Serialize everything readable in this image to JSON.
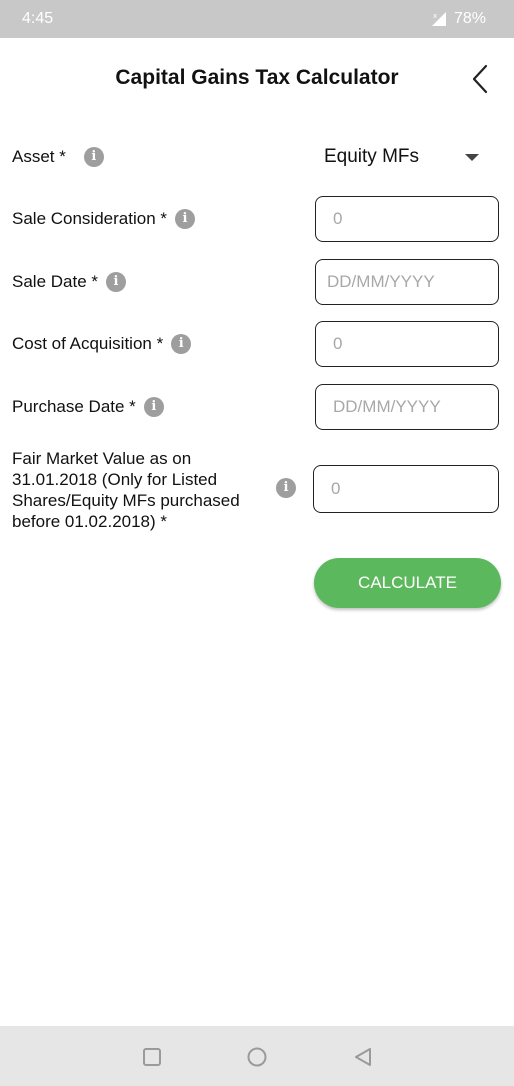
{
  "status_bar": {
    "time": "4:45",
    "battery": "78%"
  },
  "header": {
    "title": "Capital Gains Tax Calculator"
  },
  "form": {
    "asset": {
      "label": "Asset *",
      "value": "Equity MFs"
    },
    "sale_consideration": {
      "label": "Sale Consideration *",
      "placeholder": "0"
    },
    "sale_date": {
      "label": "Sale Date *",
      "placeholder": "DD/MM/YYYY"
    },
    "cost_of_acquisition": {
      "label": "Cost of Acquisition *",
      "placeholder": "0"
    },
    "purchase_date": {
      "label": "Purchase Date *",
      "placeholder": "DD/MM/YYYY"
    },
    "fair_market_value": {
      "label": "Fair Market Value as on 31.01.2018 (Only for Listed Shares/Equity MFs purchased before 01.02.2018) *",
      "placeholder": "0"
    }
  },
  "calculate_label": "CALCULATE",
  "info_glyph": "i",
  "colors": {
    "accent": "#5cb85c",
    "status_bar": "#c8c8c8",
    "nav_bar": "#e6e6e6",
    "info_icon": "#9e9e9e"
  },
  "icons": [
    "back-icon",
    "info-icon",
    "dropdown-arrow-icon",
    "signal-icon",
    "recents-icon",
    "home-icon",
    "nav-back-icon"
  ]
}
